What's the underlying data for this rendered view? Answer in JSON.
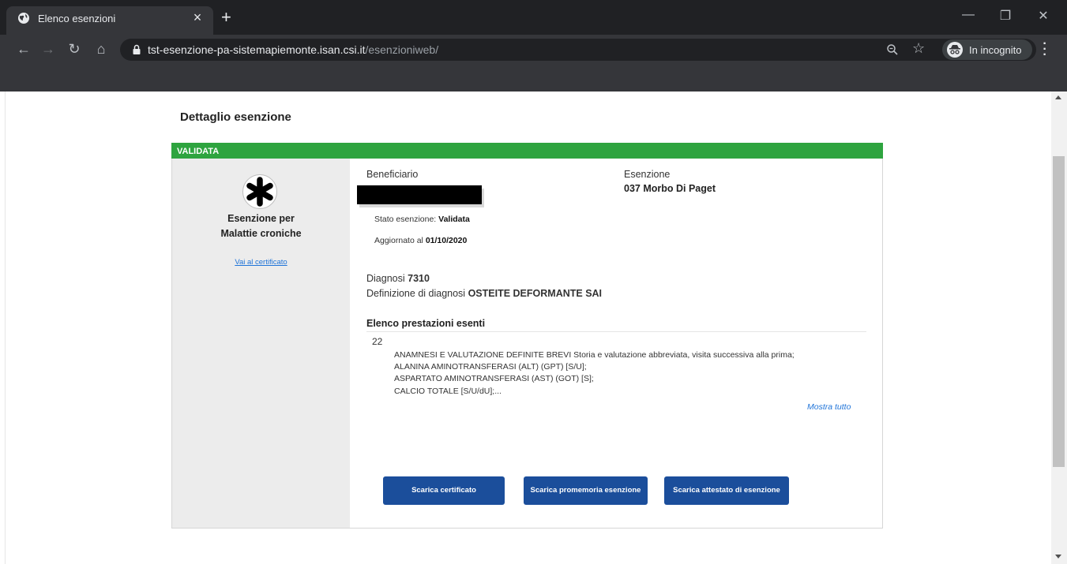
{
  "browser": {
    "tab_title": "Elenco esenzioni",
    "url_host": "tst-esenzione-pa-sistemapiemonte.isan.csi.it",
    "url_path": "/esenzioniweb/",
    "incognito_label": "In incognito",
    "icons": [
      "globe-icon",
      "close-icon",
      "plus-icon",
      "minimize-icon",
      "restore-icon",
      "window-close-icon",
      "back-icon",
      "forward-icon",
      "reload-icon",
      "home-icon",
      "lock-icon",
      "zoom-icon",
      "star-icon",
      "incognito-icon",
      "menu-icon"
    ]
  },
  "page": {
    "title": "Dettaglio esenzione",
    "status": "VALIDATA",
    "status_color": "#2ea43f"
  },
  "left_panel": {
    "icon": "asterisk-icon",
    "type_line1": "Esenzione per",
    "type_line2": "Malattie croniche",
    "certificate_link": "Vai al certificato"
  },
  "detail": {
    "beneficiary_label": "Beneficiario",
    "exemption_label": "Esenzione",
    "exemption_value": "037 Morbo Di Paget",
    "status_label": "Stato esenzione:",
    "status_value": "Validata",
    "updated_label": "Aggiornato al",
    "updated_value": "01/10/2020",
    "diagnosis_label": "Diagnosi",
    "diagnosis_value": "7310",
    "definition_label": "Definizione di diagnosi",
    "definition_value": "OSTEITE DEFORMANTE SAI"
  },
  "services": {
    "title": "Elenco prestazioni esenti",
    "count": "22",
    "items": [
      "ANAMNESI E VALUTAZIONE DEFINITE BREVI Storia e valutazione abbreviata, visita successiva alla prima;",
      "ALANINA AMINOTRANSFERASI (ALT) (GPT) [S/U];",
      "ASPARTATO AMINOTRANSFERASI (AST) (GOT) [S];",
      "CALCIO TOTALE [S/U/dU];..."
    ],
    "show_all": "Mostra tutto"
  },
  "buttons": {
    "download_certificate": "Scarica certificato",
    "download_reminder": "Scarica promemoria esenzione",
    "download_attestation": "Scarica attestato di esenzione",
    "color": "#1b4e9b"
  }
}
